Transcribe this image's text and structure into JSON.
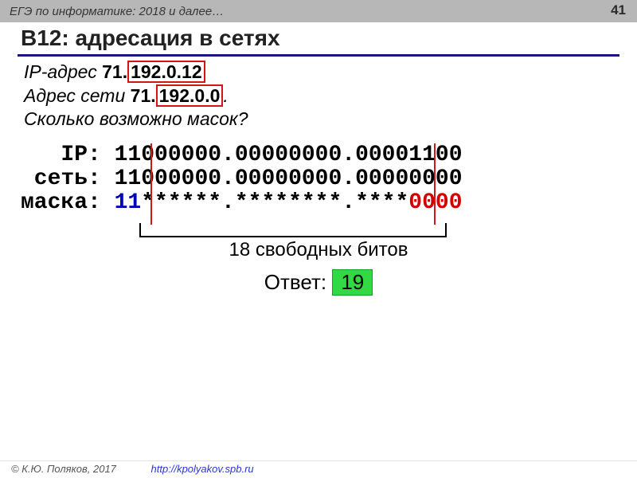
{
  "topbar_text": "ЕГЭ по информатике: 2018 и далее…",
  "slide_number": "41",
  "title": "B12: адресация в сетях",
  "ip_label": "IP-адрес  ",
  "ip_plain": "71.",
  "ip_boxed": "192.0.12",
  "net_label": "Адрес сети ",
  "net_plain_a": "71.",
  "net_boxed": "192.0.0",
  "net_plain_b": ".",
  "question": "Сколько возможно масок?",
  "mono": {
    "r1_lbl": "   IP: ",
    "r1_a": "11",
    "r1_b": "000000.00000000.00001",
    "r1_c": "100",
    "r2_lbl": " сеть: ",
    "r2_a": "11",
    "r2_b": "000000.00000000.00000",
    "r2_c": "000",
    "r3_lbl": "маска: ",
    "r3_blue": "11",
    "r3_mid": "******.********.****",
    "r3_red": "0000"
  },
  "bracket_label": "18 свободных битов",
  "answer_label": "Ответ: ",
  "answer_value": "19",
  "footer_copy": "© К.Ю. Поляков, 2017",
  "footer_url": "http://kpolyakov.spb.ru"
}
